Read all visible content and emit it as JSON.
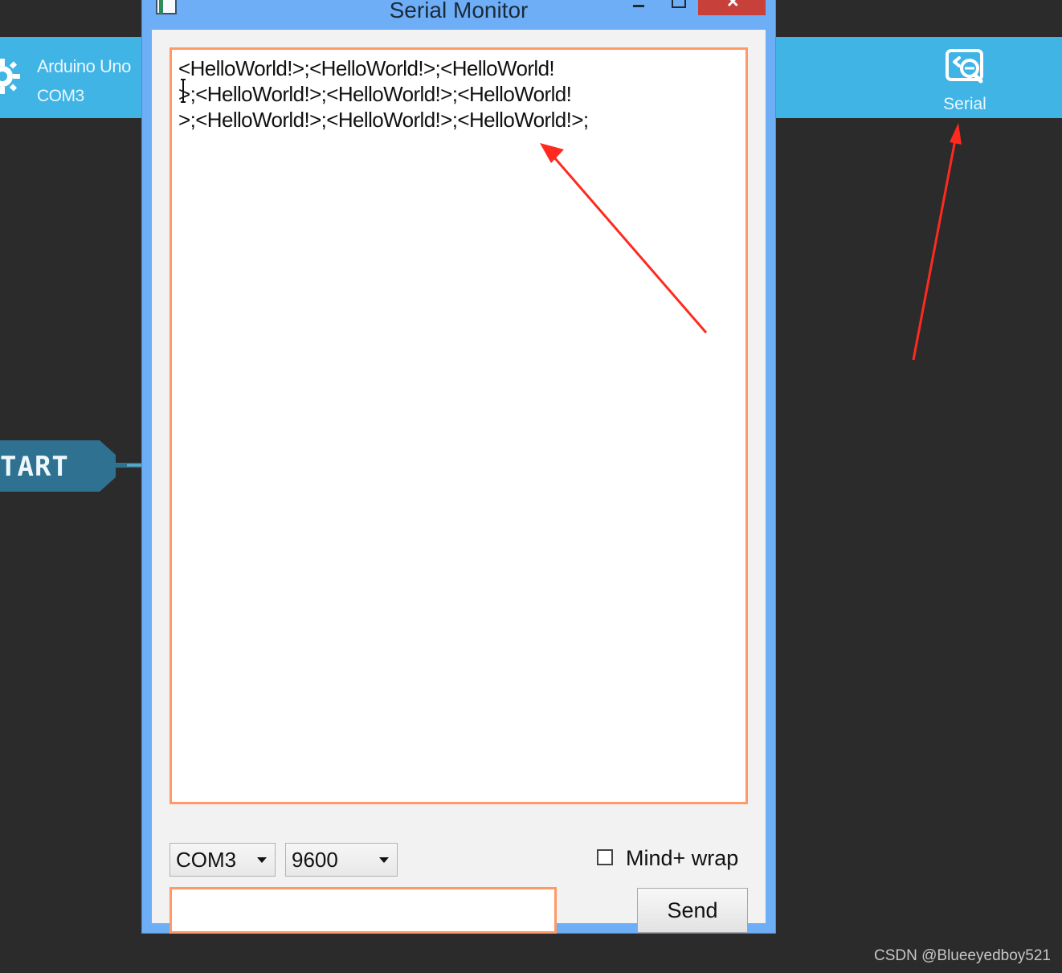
{
  "colors": {
    "desktop_background": "#2b2b2b",
    "top_bar": "#3fb4e5",
    "window_frame": "#6eaef7",
    "close_button": "#c7403a",
    "accent_border": "#ff9a66",
    "annotation_arrow": "#ff2a1f"
  },
  "background_app": {
    "board": {
      "icon": "gear-icon",
      "name": "Arduino Uno",
      "port": "COM3"
    },
    "serial_button": {
      "icon": "serial-monitor-icon",
      "label": "Serial"
    },
    "start_block": {
      "label": "TART"
    }
  },
  "serial_monitor": {
    "title": "Serial Monitor",
    "controls": {
      "minimize_icon": "minimize-icon",
      "maximize_icon": "maximize-icon",
      "close_icon": "close-icon"
    },
    "output": {
      "lines": [
        "<HelloWorld!>;<HelloWorld!>;<HelloWorld!",
        ">;<HelloWorld!>;<HelloWorld!>;<HelloWorld!",
        ">;<HelloWorld!>;<HelloWorld!>;<HelloWorld!>;"
      ]
    },
    "port_select": {
      "value": "COM3"
    },
    "baud_select": {
      "value": "9600"
    },
    "wrap_checkbox": {
      "label": "Mind+ wrap",
      "checked": false
    },
    "message_input": {
      "value": "",
      "placeholder": ""
    },
    "send_button": {
      "label": "Send"
    }
  },
  "watermark": {
    "text": "CSDN @Blueeyedboy521"
  }
}
